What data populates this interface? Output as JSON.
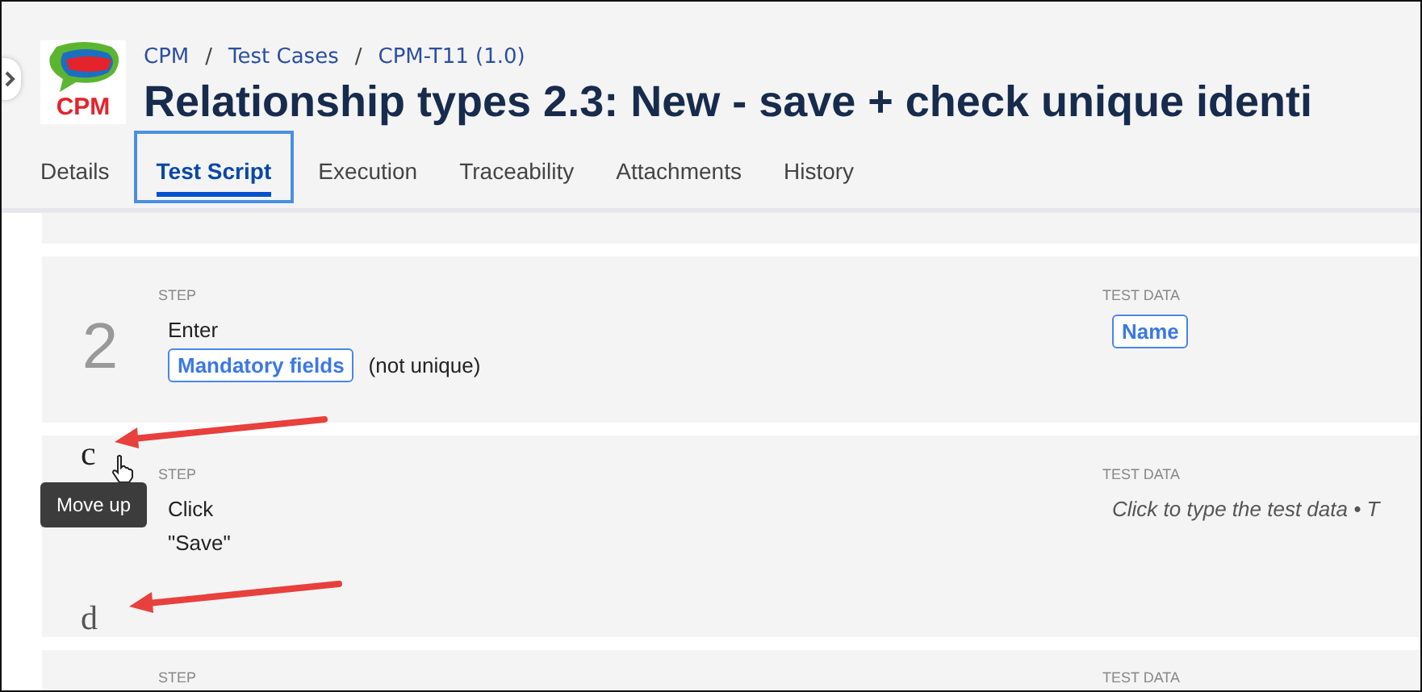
{
  "breadcrumb": {
    "items": [
      "CPM",
      "Test Cases",
      "CPM-T11 (1.0)"
    ],
    "separator": "/"
  },
  "logo": {
    "text": "CPM"
  },
  "title": "Relationship types 2.3: New - save + check unique identi",
  "tabs": [
    {
      "label": "Details",
      "selected": false
    },
    {
      "label": "Test Script",
      "selected": true
    },
    {
      "label": "Execution",
      "selected": false
    },
    {
      "label": "Traceability",
      "selected": false
    },
    {
      "label": "Attachments",
      "selected": false
    },
    {
      "label": "History",
      "selected": false
    }
  ],
  "steps": [
    {
      "number": "2",
      "step_label": "STEP",
      "lines": [
        [
          {
            "kind": "text",
            "text": "Enter"
          }
        ],
        [
          {
            "kind": "tag",
            "text": "Mandatory fields"
          },
          {
            "kind": "text",
            "text": "(not unique)"
          }
        ]
      ],
      "data_label": "TEST DATA",
      "data": [
        {
          "kind": "tag",
          "text": "Name"
        }
      ]
    },
    {
      "step_label": "STEP",
      "lines": [
        [
          {
            "kind": "text",
            "text": "Click"
          }
        ],
        [
          {
            "kind": "text",
            "text": "\"Save\""
          }
        ]
      ],
      "data_label": "TEST DATA",
      "data": [
        {
          "kind": "placeholder",
          "text": "Click to type the test data • T"
        }
      ],
      "annotations": [
        {
          "letter": "c"
        },
        {
          "letter": "d"
        }
      ],
      "tooltip": "Move up"
    },
    {
      "step_label": "STEP",
      "data_label": "TEST DATA"
    }
  ]
}
